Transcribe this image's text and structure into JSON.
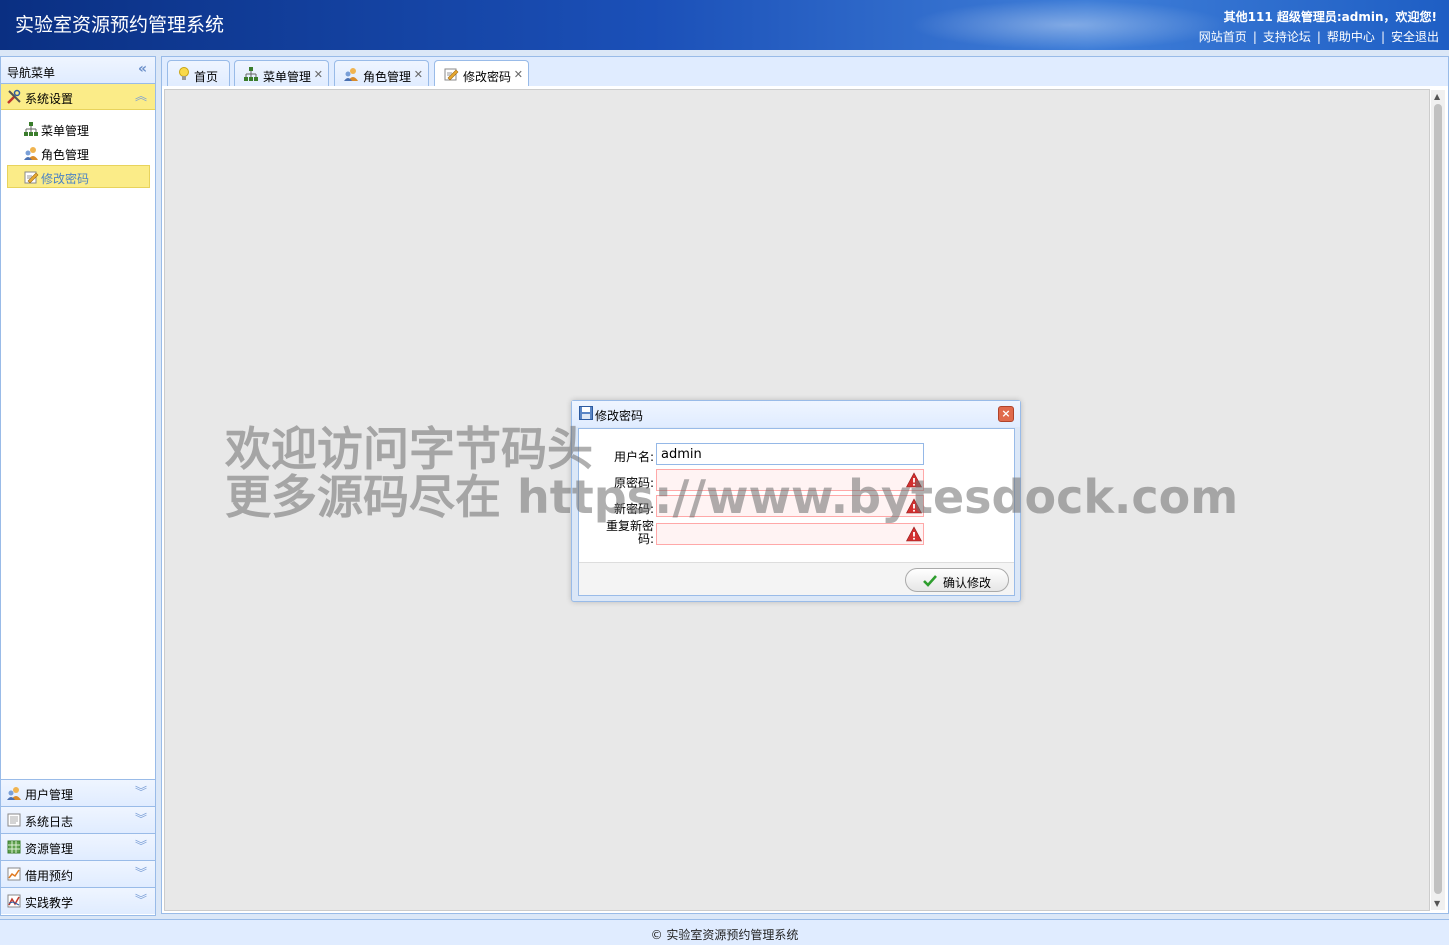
{
  "header": {
    "title": "实验室资源预约管理系统",
    "user_info": "其他111 超级管理员:admin，欢迎您!",
    "links": [
      "网站首页",
      "支持论坛",
      "帮助中心",
      "安全退出"
    ]
  },
  "sidebar": {
    "title": "导航菜单",
    "active_group": {
      "label": "系统设置",
      "icon": "tools-icon",
      "items": [
        {
          "label": "菜单管理",
          "icon": "sitemap-icon"
        },
        {
          "label": "角色管理",
          "icon": "role-icon"
        },
        {
          "label": "修改密码",
          "icon": "edit-password-icon",
          "selected": true
        }
      ]
    },
    "groups": [
      {
        "label": "用户管理",
        "icon": "users-icon"
      },
      {
        "label": "系统日志",
        "icon": "log-icon"
      },
      {
        "label": "资源管理",
        "icon": "grid-icon"
      },
      {
        "label": "借用预约",
        "icon": "chart-icon"
      },
      {
        "label": "实践教学",
        "icon": "teaching-chart-icon"
      }
    ]
  },
  "tabs": [
    {
      "label": "首页",
      "icon": "bulb-icon",
      "closable": false
    },
    {
      "label": "菜单管理",
      "icon": "sitemap-icon",
      "closable": true
    },
    {
      "label": "角色管理",
      "icon": "role-icon",
      "closable": true
    },
    {
      "label": "修改密码",
      "icon": "edit-password-icon",
      "closable": true,
      "active": true
    }
  ],
  "dialog": {
    "title": "修改密码",
    "fields": {
      "username_label": "用户名:",
      "username_value": "admin",
      "old_password_label": "原密码:",
      "new_password_label": "新密码:",
      "repeat_password_label": "重复新密码:"
    },
    "confirm_label": "确认修改",
    "close_symbol": "×"
  },
  "watermark": {
    "line1": "欢迎访问字节码头",
    "line2": "更多源码尽在  https://www.bytesdock.com"
  },
  "footer": {
    "text": "© 实验室资源预约管理系统"
  },
  "colors": {
    "header_dark": "#0a2f82",
    "header_light": "#3f7ed8",
    "panel_border": "#99bbe8",
    "selected_bg": "#fbec88",
    "invalid_bg": "#fff3f3"
  }
}
